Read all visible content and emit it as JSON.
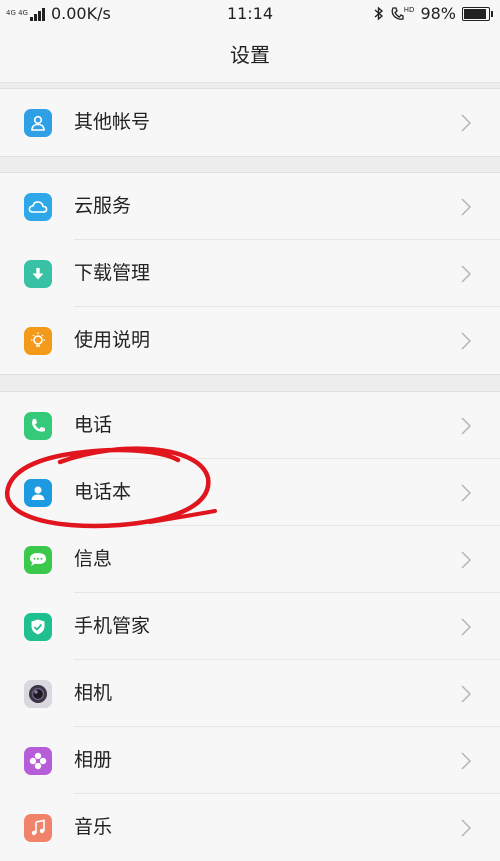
{
  "status_bar": {
    "network_type": "4G 4G",
    "speed": "0.00K/s",
    "time": "11:14",
    "hd_label": "HD",
    "battery_text": "98%",
    "battery_level": 0.98
  },
  "header": {
    "title": "设置"
  },
  "groups": [
    {
      "items": [
        {
          "label": "其他帐号",
          "icon": "account-icon",
          "color": "#2f9fe6"
        }
      ]
    },
    {
      "items": [
        {
          "label": "云服务",
          "icon": "cloud-icon",
          "color": "#2ea8e8"
        },
        {
          "label": "下载管理",
          "icon": "download-icon",
          "color": "#38c1a4"
        },
        {
          "label": "使用说明",
          "icon": "lightbulb-icon",
          "color": "#f39a1a"
        }
      ]
    },
    {
      "items": [
        {
          "label": "电话",
          "icon": "phone-icon",
          "color": "#35c97a"
        },
        {
          "label": "电话本",
          "icon": "contacts-icon",
          "color": "#1e9be0"
        },
        {
          "label": "信息",
          "icon": "message-icon",
          "color": "#3cc84a"
        },
        {
          "label": "手机管家",
          "icon": "shield-icon",
          "color": "#1fbf8f"
        },
        {
          "label": "相机",
          "icon": "camera-icon",
          "color": "#d8d8de"
        },
        {
          "label": "相册",
          "icon": "album-icon",
          "color": "#b65ed9"
        },
        {
          "label": "音乐",
          "icon": "music-icon",
          "color": "#f2836b"
        }
      ]
    }
  ],
  "colors": {
    "annotation": "#e0151d",
    "chevron": "#b5b5b5"
  }
}
